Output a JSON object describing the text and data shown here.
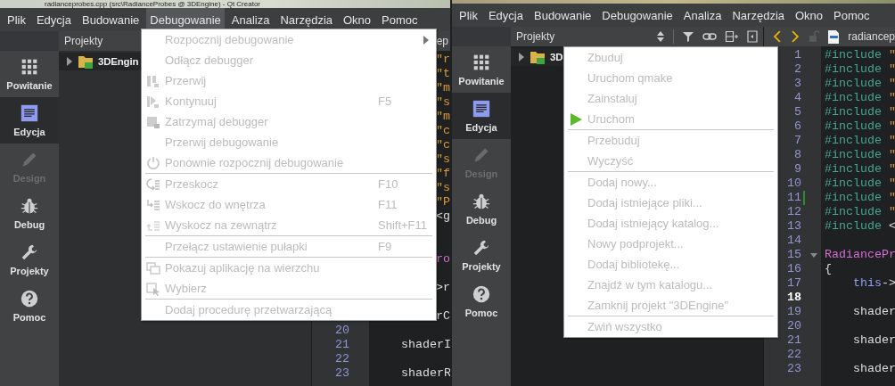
{
  "windows": [
    {
      "title": "radianceprobes.cpp (src\\RadianceProbes @ 3DEngine) - Qt Creator",
      "menu_bar": [
        {
          "label": "Plik",
          "selected": false
        },
        {
          "label": "Edycja",
          "selected": false
        },
        {
          "label": "Budowanie",
          "selected": false
        },
        {
          "label": "Debugowanie",
          "selected": true
        },
        {
          "label": "Analiza",
          "selected": false
        },
        {
          "label": "Narzędzia",
          "selected": false
        },
        {
          "label": "Okno",
          "selected": false
        },
        {
          "label": "Pomoc",
          "selected": false
        }
      ],
      "modes": [
        {
          "label": "Powitanie",
          "selected": false,
          "disabled": false
        },
        {
          "label": "Edycja",
          "selected": true,
          "disabled": false
        },
        {
          "label": "Design",
          "selected": false,
          "disabled": true
        },
        {
          "label": "Debug",
          "selected": false,
          "disabled": false
        },
        {
          "label": "Projekty",
          "selected": false,
          "disabled": false
        },
        {
          "label": "Pomoc",
          "selected": false,
          "disabled": false
        }
      ],
      "projects_panel": {
        "title": "Projekty",
        "tree": [
          {
            "label": "3DEngin",
            "expanded": false
          }
        ]
      },
      "editor": {
        "file": "ep",
        "lines": [
          {
            "kind": "tail",
            "tokens": [
              {
                "text": "\"r",
                "kind": "string"
              }
            ]
          },
          {
            "kind": "tail",
            "tokens": [
              {
                "text": "\"t",
                "kind": "string"
              }
            ]
          },
          {
            "kind": "tail",
            "tokens": [
              {
                "text": "\"m",
                "kind": "string"
              }
            ]
          },
          {
            "kind": "tail",
            "tokens": [
              {
                "text": "\"s",
                "kind": "string"
              }
            ]
          },
          {
            "kind": "tail",
            "tokens": [
              {
                "text": "\"m",
                "kind": "string"
              }
            ]
          },
          {
            "kind": "tail",
            "tokens": [
              {
                "text": "\"c",
                "kind": "string"
              }
            ]
          },
          {
            "kind": "tail",
            "tokens": [
              {
                "text": "\"c",
                "kind": "string"
              }
            ]
          },
          {
            "kind": "tail",
            "tokens": [
              {
                "text": "\"s",
                "kind": "string"
              }
            ]
          },
          {
            "kind": "tail",
            "tokens": [
              {
                "text": "\"f",
                "kind": "string"
              }
            ]
          },
          {
            "kind": "tail",
            "tokens": [
              {
                "text": "\"s",
                "kind": "string"
              }
            ]
          },
          {
            "kind": "tail",
            "tokens": [
              {
                "text": "\"P",
                "kind": "string"
              }
            ]
          },
          {
            "kind": "tail",
            "tokens": [
              {
                "text": "<g",
                "kind": "plain"
              }
            ]
          },
          {
            "kind": "blank"
          },
          {
            "kind": "blank"
          },
          {
            "kind": "tail",
            "tokens": [
              {
                "text": "ro",
                "kind": "type"
              }
            ]
          },
          {
            "kind": "blank"
          },
          {
            "kind": "tail",
            "tokens": [
              {
                "text": ">r",
                "kind": "plain"
              }
            ]
          },
          {
            "kind": "blank"
          },
          {
            "kind": "tail",
            "tokens": [
              {
                "text": "rC",
                "kind": "plain"
              }
            ]
          },
          {
            "kind": "blank",
            "number": "20"
          },
          {
            "kind": "code",
            "number": "21",
            "tokens": [
              {
                "text": "    shaderI",
                "kind": "plain"
              }
            ]
          },
          {
            "kind": "blank",
            "number": "22"
          },
          {
            "kind": "code",
            "number": "23",
            "tokens": [
              {
                "text": "    shaderR",
                "kind": "plain"
              }
            ]
          }
        ]
      },
      "menu": {
        "kind": "dropdown",
        "items": [
          {
            "kind": "submenu",
            "label": "Rozpocznij debugowanie",
            "disabled": true
          },
          {
            "kind": "text",
            "label": "Odłącz debugger",
            "disabled": true
          },
          {
            "kind": "pause",
            "label": "Przerwij",
            "disabled": true
          },
          {
            "kind": "resume",
            "label": "Kontynuuj",
            "shortcut": "F5",
            "disabled": true
          },
          {
            "kind": "halt",
            "label": "Zatrzymaj debugger",
            "disabled": true
          },
          {
            "kind": "text",
            "label": "Przerwij debugowanie",
            "disabled": true
          },
          {
            "kind": "restart",
            "label": "Ponownie rozpocznij debugowanie",
            "disabled": true
          },
          {
            "kind": "separator"
          },
          {
            "kind": "stepover",
            "label": "Przeskocz",
            "shortcut": "F10",
            "disabled": true
          },
          {
            "kind": "stepinto",
            "label": "Wskocz do wnętrza",
            "shortcut": "F11",
            "disabled": true
          },
          {
            "kind": "stepout",
            "label": "Wyskocz na zewnątrz",
            "shortcut": "Shift+F11",
            "disabled": true
          },
          {
            "kind": "separator"
          },
          {
            "kind": "text",
            "label": "Przełącz ustawienie pułapki",
            "shortcut": "F9",
            "disabled": true
          },
          {
            "kind": "separator"
          },
          {
            "kind": "ontop",
            "label": "Pokazuj aplikację na wierzchu",
            "disabled": true
          },
          {
            "kind": "pick",
            "label": "Wybierz",
            "disabled": true
          },
          {
            "kind": "separator"
          },
          {
            "kind": "text",
            "label": "Dodaj procedurę przetwarzającą",
            "disabled": true
          }
        ]
      }
    },
    {
      "menu_bar": [
        {
          "label": "Plik",
          "selected": false
        },
        {
          "label": "Edycja",
          "selected": false
        },
        {
          "label": "Budowanie",
          "selected": false
        },
        {
          "label": "Debugowanie",
          "selected": false
        },
        {
          "label": "Analiza",
          "selected": false
        },
        {
          "label": "Narzędzia",
          "selected": false
        },
        {
          "label": "Okno",
          "selected": false
        },
        {
          "label": "Pomoc",
          "selected": false
        }
      ],
      "modes": [
        {
          "label": "Powitanie",
          "selected": false,
          "disabled": false
        },
        {
          "label": "Edycja",
          "selected": true,
          "disabled": false
        },
        {
          "label": "Design",
          "selected": false,
          "disabled": true
        },
        {
          "label": "Debug",
          "selected": false,
          "disabled": false
        },
        {
          "label": "Projekty",
          "selected": false,
          "disabled": false
        },
        {
          "label": "Pomoc",
          "selected": false,
          "disabled": false
        }
      ],
      "projects_panel": {
        "title": "Projekty",
        "tree": [
          {
            "label": "3D",
            "expanded": false
          }
        ]
      },
      "editor": {
        "file": "radiancep",
        "lines": [
          {
            "kind": "code",
            "number": "1",
            "current": false,
            "changed": false,
            "foldable": false,
            "tokens": [
              {
                "text": "#include",
                "kind": "directive"
              },
              {
                "text": " \"",
                "kind": "string"
              }
            ]
          },
          {
            "kind": "code",
            "number": "2",
            "current": false,
            "changed": false,
            "foldable": false,
            "tokens": [
              {
                "text": "#include",
                "kind": "directive"
              },
              {
                "text": " \"",
                "kind": "string"
              }
            ]
          },
          {
            "kind": "code",
            "number": "3",
            "current": false,
            "changed": false,
            "foldable": false,
            "tokens": [
              {
                "text": "#include",
                "kind": "directive"
              },
              {
                "text": " \"",
                "kind": "string"
              }
            ]
          },
          {
            "kind": "code",
            "number": "4",
            "current": false,
            "changed": false,
            "foldable": false,
            "tokens": [
              {
                "text": "#include",
                "kind": "directive"
              },
              {
                "text": " \"",
                "kind": "string"
              }
            ]
          },
          {
            "kind": "code",
            "number": "5",
            "current": false,
            "changed": false,
            "foldable": false,
            "tokens": [
              {
                "text": "#include",
                "kind": "directive"
              },
              {
                "text": " \"",
                "kind": "string"
              }
            ]
          },
          {
            "kind": "code",
            "number": "6",
            "current": false,
            "changed": false,
            "foldable": false,
            "tokens": [
              {
                "text": "#include",
                "kind": "directive"
              },
              {
                "text": " \"",
                "kind": "string"
              }
            ]
          },
          {
            "kind": "code",
            "number": "7",
            "current": false,
            "changed": false,
            "foldable": false,
            "tokens": [
              {
                "text": "#include",
                "kind": "directive"
              },
              {
                "text": " \"",
                "kind": "string"
              }
            ]
          },
          {
            "kind": "code",
            "number": "8",
            "current": false,
            "changed": false,
            "foldable": false,
            "tokens": [
              {
                "text": "#include",
                "kind": "directive"
              },
              {
                "text": " \"",
                "kind": "string"
              }
            ]
          },
          {
            "kind": "code",
            "number": "9",
            "current": false,
            "changed": false,
            "foldable": false,
            "tokens": [
              {
                "text": "#include",
                "kind": "directive"
              },
              {
                "text": " \"",
                "kind": "string"
              }
            ]
          },
          {
            "kind": "code",
            "number": "10",
            "current": false,
            "changed": false,
            "foldable": false,
            "tokens": [
              {
                "text": "#include",
                "kind": "directive"
              },
              {
                "text": " \"",
                "kind": "string"
              }
            ]
          },
          {
            "kind": "code",
            "number": "11",
            "current": false,
            "changed": true,
            "foldable": false,
            "tokens": [
              {
                "text": "#include",
                "kind": "directive"
              },
              {
                "text": " \"",
                "kind": "string"
              }
            ]
          },
          {
            "kind": "code",
            "number": "12",
            "current": false,
            "changed": false,
            "foldable": false,
            "tokens": [
              {
                "text": "#include",
                "kind": "directive"
              },
              {
                "text": " \"",
                "kind": "string"
              }
            ]
          },
          {
            "kind": "code",
            "number": "13",
            "current": false,
            "changed": false,
            "foldable": false,
            "tokens": [
              {
                "text": "#include",
                "kind": "directive"
              },
              {
                "text": " <",
                "kind": "plain"
              }
            ]
          },
          {
            "kind": "blank",
            "number": "14",
            "current": false,
            "changed": false,
            "foldable": false
          },
          {
            "kind": "code",
            "number": "15",
            "current": false,
            "changed": false,
            "foldable": true,
            "tokens": [
              {
                "text": "RadiancePr",
                "kind": "type"
              }
            ]
          },
          {
            "kind": "code",
            "number": "16",
            "current": false,
            "changed": false,
            "foldable": false,
            "tokens": [
              {
                "text": "{",
                "kind": "plain"
              }
            ]
          },
          {
            "kind": "code",
            "number": "17",
            "current": false,
            "changed": false,
            "foldable": false,
            "tokens": [
              {
                "text": "    this",
                "kind": "keyword"
              },
              {
                "text": "->",
                "kind": "plain"
              }
            ]
          },
          {
            "kind": "blank",
            "number": "18",
            "current": true,
            "changed": false,
            "foldable": false
          },
          {
            "kind": "code",
            "number": "19",
            "current": false,
            "changed": false,
            "foldable": false,
            "tokens": [
              {
                "text": "    shader",
                "kind": "plain"
              }
            ]
          },
          {
            "kind": "blank",
            "number": "20",
            "current": false,
            "changed": false,
            "foldable": false
          },
          {
            "kind": "code",
            "number": "21",
            "current": false,
            "changed": false,
            "foldable": false,
            "tokens": [
              {
                "text": "    shader",
                "kind": "plain"
              }
            ]
          },
          {
            "kind": "blank",
            "number": "22",
            "current": false,
            "changed": false,
            "foldable": false
          },
          {
            "kind": "code",
            "number": "23",
            "current": false,
            "changed": false,
            "foldable": false,
            "tokens": [
              {
                "text": "    shader",
                "kind": "plain"
              }
            ]
          }
        ]
      },
      "menu": {
        "kind": "context",
        "items": [
          {
            "kind": "text",
            "label": "Zbuduj",
            "disabled": true
          },
          {
            "kind": "text",
            "label": "Uruchom qmake",
            "disabled": true
          },
          {
            "kind": "text",
            "label": "Zainstaluj",
            "disabled": true
          },
          {
            "kind": "run",
            "label": "Uruchom",
            "disabled": true
          },
          {
            "kind": "separator"
          },
          {
            "kind": "text",
            "label": "Przebuduj",
            "disabled": true
          },
          {
            "kind": "text",
            "label": "Wyczyść",
            "disabled": true
          },
          {
            "kind": "separator"
          },
          {
            "kind": "text",
            "label": "Dodaj nowy...",
            "disabled": true
          },
          {
            "kind": "text",
            "label": "Dodaj istniejące pliki...",
            "disabled": true
          },
          {
            "kind": "text",
            "label": "Dodaj istniejący katalog...",
            "disabled": true
          },
          {
            "kind": "text",
            "label": "Nowy podprojekt...",
            "disabled": true
          },
          {
            "kind": "text",
            "label": "Dodaj bibliotekę...",
            "disabled": true
          },
          {
            "kind": "text",
            "label": "Znajdź w tym katalogu...",
            "disabled": true
          },
          {
            "kind": "text",
            "label": "Zamknij projekt \"3DEngine\"",
            "disabled": true
          },
          {
            "kind": "separator"
          },
          {
            "kind": "text",
            "label": "Zwiń wszystko",
            "disabled": true
          }
        ]
      }
    }
  ]
}
